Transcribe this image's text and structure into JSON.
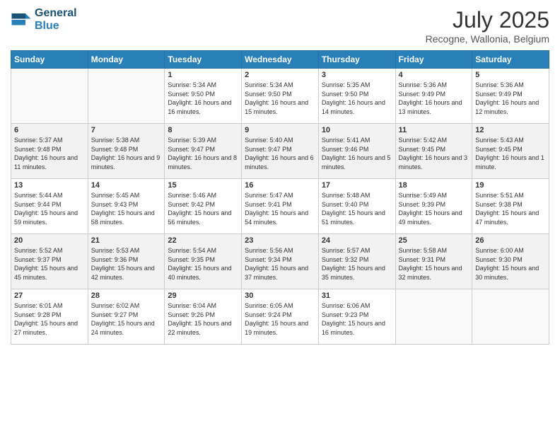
{
  "logo": {
    "line1": "General",
    "line2": "Blue"
  },
  "header": {
    "month_year": "July 2025",
    "location": "Recogne, Wallonia, Belgium"
  },
  "weekdays": [
    "Sunday",
    "Monday",
    "Tuesday",
    "Wednesday",
    "Thursday",
    "Friday",
    "Saturday"
  ],
  "weeks": [
    [
      {
        "day": "",
        "sunrise": "",
        "sunset": "",
        "daylight": ""
      },
      {
        "day": "",
        "sunrise": "",
        "sunset": "",
        "daylight": ""
      },
      {
        "day": "1",
        "sunrise": "Sunrise: 5:34 AM",
        "sunset": "Sunset: 9:50 PM",
        "daylight": "Daylight: 16 hours and 16 minutes."
      },
      {
        "day": "2",
        "sunrise": "Sunrise: 5:34 AM",
        "sunset": "Sunset: 9:50 PM",
        "daylight": "Daylight: 16 hours and 15 minutes."
      },
      {
        "day": "3",
        "sunrise": "Sunrise: 5:35 AM",
        "sunset": "Sunset: 9:50 PM",
        "daylight": "Daylight: 16 hours and 14 minutes."
      },
      {
        "day": "4",
        "sunrise": "Sunrise: 5:36 AM",
        "sunset": "Sunset: 9:49 PM",
        "daylight": "Daylight: 16 hours and 13 minutes."
      },
      {
        "day": "5",
        "sunrise": "Sunrise: 5:36 AM",
        "sunset": "Sunset: 9:49 PM",
        "daylight": "Daylight: 16 hours and 12 minutes."
      }
    ],
    [
      {
        "day": "6",
        "sunrise": "Sunrise: 5:37 AM",
        "sunset": "Sunset: 9:48 PM",
        "daylight": "Daylight: 16 hours and 11 minutes."
      },
      {
        "day": "7",
        "sunrise": "Sunrise: 5:38 AM",
        "sunset": "Sunset: 9:48 PM",
        "daylight": "Daylight: 16 hours and 9 minutes."
      },
      {
        "day": "8",
        "sunrise": "Sunrise: 5:39 AM",
        "sunset": "Sunset: 9:47 PM",
        "daylight": "Daylight: 16 hours and 8 minutes."
      },
      {
        "day": "9",
        "sunrise": "Sunrise: 5:40 AM",
        "sunset": "Sunset: 9:47 PM",
        "daylight": "Daylight: 16 hours and 6 minutes."
      },
      {
        "day": "10",
        "sunrise": "Sunrise: 5:41 AM",
        "sunset": "Sunset: 9:46 PM",
        "daylight": "Daylight: 16 hours and 5 minutes."
      },
      {
        "day": "11",
        "sunrise": "Sunrise: 5:42 AM",
        "sunset": "Sunset: 9:45 PM",
        "daylight": "Daylight: 16 hours and 3 minutes."
      },
      {
        "day": "12",
        "sunrise": "Sunrise: 5:43 AM",
        "sunset": "Sunset: 9:45 PM",
        "daylight": "Daylight: 16 hours and 1 minute."
      }
    ],
    [
      {
        "day": "13",
        "sunrise": "Sunrise: 5:44 AM",
        "sunset": "Sunset: 9:44 PM",
        "daylight": "Daylight: 15 hours and 59 minutes."
      },
      {
        "day": "14",
        "sunrise": "Sunrise: 5:45 AM",
        "sunset": "Sunset: 9:43 PM",
        "daylight": "Daylight: 15 hours and 58 minutes."
      },
      {
        "day": "15",
        "sunrise": "Sunrise: 5:46 AM",
        "sunset": "Sunset: 9:42 PM",
        "daylight": "Daylight: 15 hours and 56 minutes."
      },
      {
        "day": "16",
        "sunrise": "Sunrise: 5:47 AM",
        "sunset": "Sunset: 9:41 PM",
        "daylight": "Daylight: 15 hours and 54 minutes."
      },
      {
        "day": "17",
        "sunrise": "Sunrise: 5:48 AM",
        "sunset": "Sunset: 9:40 PM",
        "daylight": "Daylight: 15 hours and 51 minutes."
      },
      {
        "day": "18",
        "sunrise": "Sunrise: 5:49 AM",
        "sunset": "Sunset: 9:39 PM",
        "daylight": "Daylight: 15 hours and 49 minutes."
      },
      {
        "day": "19",
        "sunrise": "Sunrise: 5:51 AM",
        "sunset": "Sunset: 9:38 PM",
        "daylight": "Daylight: 15 hours and 47 minutes."
      }
    ],
    [
      {
        "day": "20",
        "sunrise": "Sunrise: 5:52 AM",
        "sunset": "Sunset: 9:37 PM",
        "daylight": "Daylight: 15 hours and 45 minutes."
      },
      {
        "day": "21",
        "sunrise": "Sunrise: 5:53 AM",
        "sunset": "Sunset: 9:36 PM",
        "daylight": "Daylight: 15 hours and 42 minutes."
      },
      {
        "day": "22",
        "sunrise": "Sunrise: 5:54 AM",
        "sunset": "Sunset: 9:35 PM",
        "daylight": "Daylight: 15 hours and 40 minutes."
      },
      {
        "day": "23",
        "sunrise": "Sunrise: 5:56 AM",
        "sunset": "Sunset: 9:34 PM",
        "daylight": "Daylight: 15 hours and 37 minutes."
      },
      {
        "day": "24",
        "sunrise": "Sunrise: 5:57 AM",
        "sunset": "Sunset: 9:32 PM",
        "daylight": "Daylight: 15 hours and 35 minutes."
      },
      {
        "day": "25",
        "sunrise": "Sunrise: 5:58 AM",
        "sunset": "Sunset: 9:31 PM",
        "daylight": "Daylight: 15 hours and 32 minutes."
      },
      {
        "day": "26",
        "sunrise": "Sunrise: 6:00 AM",
        "sunset": "Sunset: 9:30 PM",
        "daylight": "Daylight: 15 hours and 30 minutes."
      }
    ],
    [
      {
        "day": "27",
        "sunrise": "Sunrise: 6:01 AM",
        "sunset": "Sunset: 9:28 PM",
        "daylight": "Daylight: 15 hours and 27 minutes."
      },
      {
        "day": "28",
        "sunrise": "Sunrise: 6:02 AM",
        "sunset": "Sunset: 9:27 PM",
        "daylight": "Daylight: 15 hours and 24 minutes."
      },
      {
        "day": "29",
        "sunrise": "Sunrise: 6:04 AM",
        "sunset": "Sunset: 9:26 PM",
        "daylight": "Daylight: 15 hours and 22 minutes."
      },
      {
        "day": "30",
        "sunrise": "Sunrise: 6:05 AM",
        "sunset": "Sunset: 9:24 PM",
        "daylight": "Daylight: 15 hours and 19 minutes."
      },
      {
        "day": "31",
        "sunrise": "Sunrise: 6:06 AM",
        "sunset": "Sunset: 9:23 PM",
        "daylight": "Daylight: 15 hours and 16 minutes."
      },
      {
        "day": "",
        "sunrise": "",
        "sunset": "",
        "daylight": ""
      },
      {
        "day": "",
        "sunrise": "",
        "sunset": "",
        "daylight": ""
      }
    ]
  ]
}
